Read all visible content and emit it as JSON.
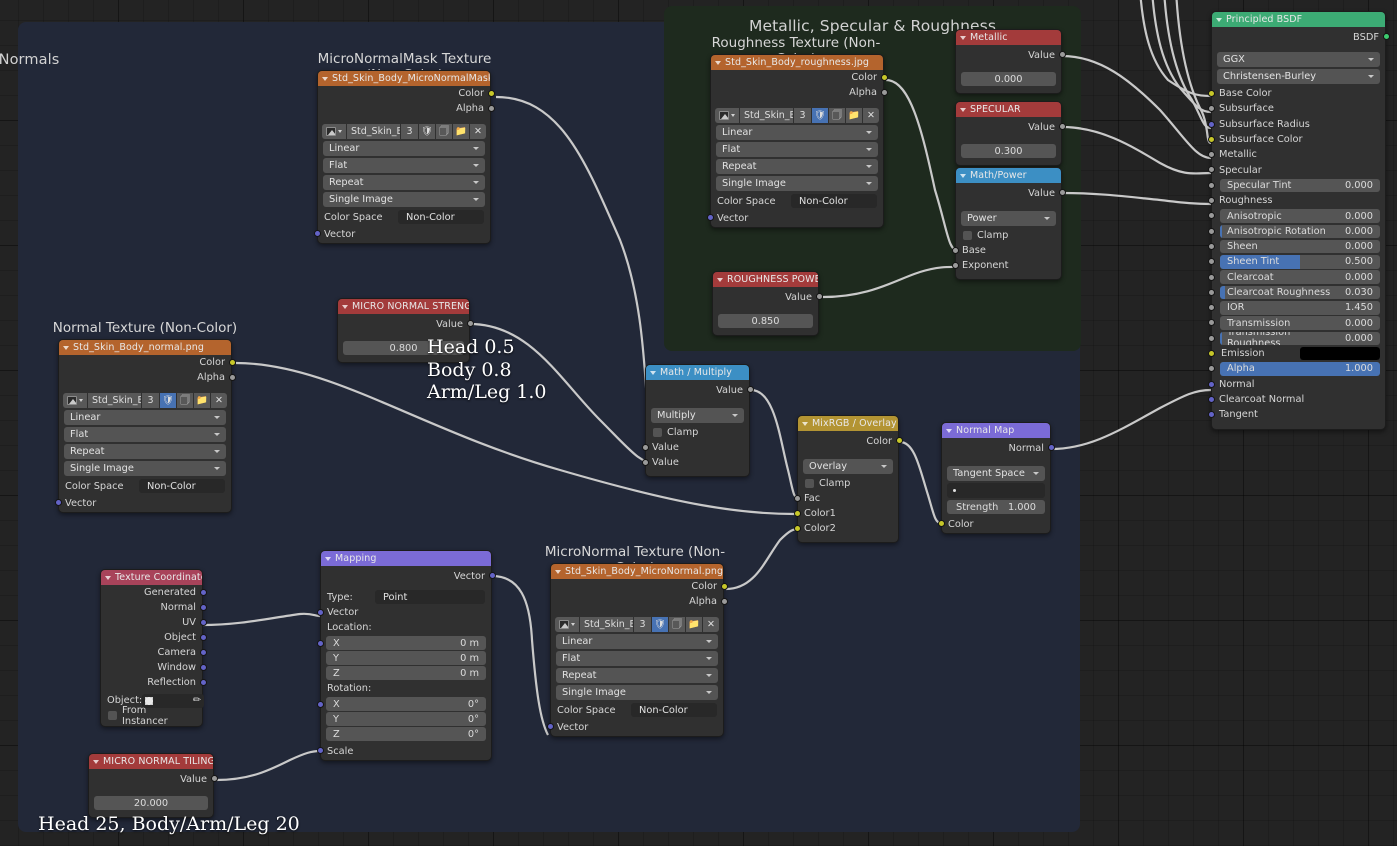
{
  "editor": {
    "name": "blender-shader-node-editor",
    "background": "#232323"
  },
  "frames": [
    {
      "label": "Normals",
      "color": "#222838"
    },
    {
      "label": "Metallic, Specular & Roughness",
      "color": "#1e2a1e"
    }
  ],
  "annotations": [
    {
      "text": "Head 0.5\nBody 0.8\nArm/Leg 1.0"
    },
    {
      "text": "Head 25, Body/Arm/Leg 20"
    }
  ],
  "labels": {
    "micro_normal_mask_texture": "MicroNormalMask Texture (Non-Color)",
    "roughness_texture": "Roughness Texture (Non-Color)",
    "normal_texture": "Normal Texture (Non-Color)",
    "micro_normal_texture": "MicroNormal Texture (Non-Color)"
  },
  "common": {
    "color": "Color",
    "alpha": "Alpha",
    "vector": "Vector",
    "value": "Value",
    "clamp": "Clamp",
    "interpolation": "Linear",
    "projection": "Flat",
    "extension": "Repeat",
    "source": "Single Image",
    "color_space_label": "Color Space",
    "color_space_value": "Non-Color",
    "image_name": "Std_Skin_Bo...",
    "users": "3"
  },
  "nodes": {
    "micro_normal_mask": {
      "title": "Std_Skin_Body_MicroNormalMask.jpg",
      "header_color": "#b4642d",
      "outputs": [
        "Color",
        "Alpha"
      ],
      "inputs": [
        "Vector"
      ]
    },
    "roughness_tex": {
      "title": "Std_Skin_Body_roughness.jpg",
      "header_color": "#b4642d",
      "outputs": [
        "Color",
        "Alpha"
      ],
      "inputs": [
        "Vector"
      ]
    },
    "normal_tex": {
      "title": "Std_Skin_Body_normal.png",
      "header_color": "#b4642d",
      "outputs": [
        "Color",
        "Alpha"
      ],
      "inputs": [
        "Vector"
      ]
    },
    "micro_normal_tex": {
      "title": "Std_Skin_Body_MicroNormal.png",
      "header_color": "#b4642d",
      "outputs": [
        "Color",
        "Alpha"
      ],
      "inputs": [
        "Vector"
      ]
    },
    "metallic": {
      "title": "Metallic",
      "header_color": "#a33b3b",
      "output_label": "Value",
      "value": "0.000"
    },
    "specular": {
      "title": "SPECULAR",
      "header_color": "#a33b3b",
      "output_label": "Value",
      "value": "0.300"
    },
    "math_power": {
      "title": "Math/Power",
      "header_color": "#3c8fc4",
      "output_label": "Value",
      "operation": "Power",
      "clamp_label": "Clamp",
      "inputs": [
        "Base",
        "Exponent"
      ]
    },
    "roughness_power": {
      "title": "ROUGHNESS POWER",
      "header_color": "#a33b3b",
      "output_label": "Value",
      "value": "0.850"
    },
    "micro_normal_strength": {
      "title": "MICRO NORMAL STRENG...",
      "header_color": "#a33b3b",
      "output_label": "Value",
      "value": "0.800"
    },
    "micro_normal_tiling": {
      "title": "MICRO NORMAL TILING",
      "header_color": "#a33b3b",
      "output_label": "Value",
      "value": "20.000"
    },
    "math_multiply": {
      "title": "Math / Multiply",
      "header_color": "#3c8fc4",
      "output_label": "Value",
      "operation": "Multiply",
      "clamp_label": "Clamp",
      "inputs": [
        "Value",
        "Value"
      ]
    },
    "mix_rgb": {
      "title": "MixRGB / Overlay",
      "header_color": "#b39433",
      "output_label": "Color",
      "blend_mode": "Overlay",
      "clamp_label": "Clamp",
      "inputs": [
        "Fac",
        "Color1",
        "Color2"
      ]
    },
    "normal_map": {
      "title": "Normal Map",
      "header_color": "#7b6bd6",
      "output_label": "Normal",
      "space": "Tangent Space",
      "uv_map": "",
      "strength_label": "Strength",
      "strength_value": "1.000",
      "color_input": "Color"
    },
    "texture_coordinate": {
      "title": "Texture Coordinate",
      "header_color": "#a8435a",
      "outputs": [
        "Generated",
        "Normal",
        "UV",
        "Object",
        "Camera",
        "Window",
        "Reflection"
      ],
      "object_label": "Object:",
      "from_instancer_label": "From Instancer"
    },
    "mapping": {
      "title": "Mapping",
      "header_color": "#7b6bd6",
      "output_label": "Vector",
      "type_label": "Type:",
      "type_value": "Point",
      "vector_input": "Vector",
      "location_label": "Location:",
      "location": [
        {
          "axis": "X",
          "value": "0 m"
        },
        {
          "axis": "Y",
          "value": "0 m"
        },
        {
          "axis": "Z",
          "value": "0 m"
        }
      ],
      "rotation_label": "Rotation:",
      "rotation": [
        {
          "axis": "X",
          "value": "0°"
        },
        {
          "axis": "Y",
          "value": "0°"
        },
        {
          "axis": "Z",
          "value": "0°"
        }
      ],
      "scale_input": "Scale"
    },
    "principled_bsdf": {
      "title": "Principled BSDF",
      "header_color": "#3cab74",
      "output_label": "BSDF",
      "distribution": "GGX",
      "subsurface_method": "Christensen-Burley",
      "sockets": [
        {
          "label": "Base Color",
          "type": "color",
          "value": null,
          "slider": 0
        },
        {
          "label": "Subsurface",
          "type": "value",
          "value": null,
          "slider": 0
        },
        {
          "label": "Subsurface Radius",
          "type": "vector",
          "value": null,
          "slider": 0
        },
        {
          "label": "Subsurface Color",
          "type": "color",
          "value": null,
          "slider": 0
        },
        {
          "label": "Metallic",
          "type": "value",
          "value": null,
          "slider": 0
        },
        {
          "label": "Specular",
          "type": "value",
          "value": null,
          "slider": 0
        },
        {
          "label": "Specular Tint",
          "type": "value",
          "value": "0.000",
          "slider": 0
        },
        {
          "label": "Roughness",
          "type": "value",
          "value": null,
          "slider": 0
        },
        {
          "label": "Anisotropic",
          "type": "value",
          "value": "0.000",
          "slider": 0
        },
        {
          "label": "Anisotropic Rotation",
          "type": "value",
          "value": "0.000",
          "slider": 1
        },
        {
          "label": "Sheen",
          "type": "value",
          "value": "0.000",
          "slider": 0
        },
        {
          "label": "Sheen Tint",
          "type": "value",
          "value": "0.500",
          "slider": 50
        },
        {
          "label": "Clearcoat",
          "type": "value",
          "value": "0.000",
          "slider": 0
        },
        {
          "label": "Clearcoat Roughness",
          "type": "value",
          "value": "0.030",
          "slider": 3
        },
        {
          "label": "IOR",
          "type": "value",
          "value": "1.450",
          "slider": 0
        },
        {
          "label": "Transmission",
          "type": "value",
          "value": "0.000",
          "slider": 0
        },
        {
          "label": "Transmission Roughness",
          "type": "value",
          "value": "0.000",
          "slider": 1
        },
        {
          "label": "Emission",
          "type": "color",
          "value": null,
          "slider": 0,
          "swatch": "#000000"
        },
        {
          "label": "Alpha",
          "type": "value",
          "value": "1.000",
          "slider": 100
        },
        {
          "label": "Normal",
          "type": "vector",
          "value": null,
          "slider": 0
        },
        {
          "label": "Clearcoat Normal",
          "type": "vector",
          "value": null,
          "slider": 0
        },
        {
          "label": "Tangent",
          "type": "vector",
          "value": null,
          "slider": 0
        }
      ]
    }
  }
}
